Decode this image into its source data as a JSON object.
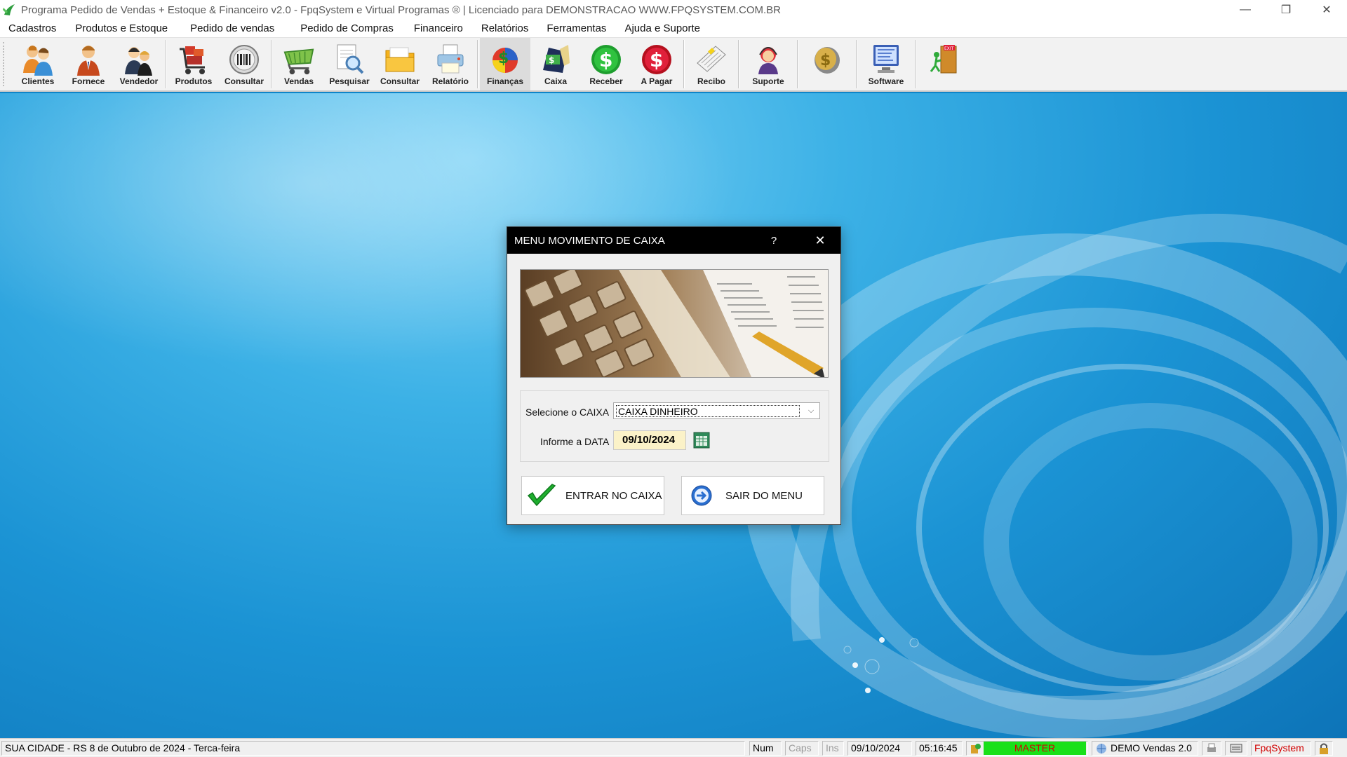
{
  "window": {
    "title": "Programa Pedido de Vendas + Estoque & Financeiro v2.0 - FpqSystem e Virtual Programas ® | Licenciado para  DEMONSTRACAO WWW.FPQSYSTEM.COM.BR",
    "controls": {
      "minimize": "—",
      "restore": "❐",
      "close": "✕"
    }
  },
  "menu": [
    "Cadastros",
    "Produtos e Estoque",
    "Pedido de vendas",
    "Pedido de Compras",
    "Financeiro",
    "Relatórios",
    "Ferramentas",
    "Ajuda e Suporte"
  ],
  "toolbar": {
    "clientes": "Clientes",
    "fornece": "Fornece",
    "vendedor": "Vendedor",
    "produtos": "Produtos",
    "consultar1": "Consultar",
    "vendas": "Vendas",
    "pesquisar": "Pesquisar",
    "consultar2": "Consultar",
    "relatorio": "Relatório",
    "financas": "Finanças",
    "caixa": "Caixa",
    "receber": "Receber",
    "apagar": "A Pagar",
    "recibo": "Recibo",
    "suporte": "Suporte",
    "software": "Software"
  },
  "dialog": {
    "title": "MENU MOVIMENTO DE CAIXA",
    "help": "?",
    "close": "✕",
    "caixa_label": "Selecione o CAIXA",
    "caixa_value": "CAIXA DINHEIRO",
    "data_label": "Informe a DATA",
    "data_value": "09/10/2024",
    "entrar_label": "ENTRAR NO CAIXA",
    "sair_label": "SAIR DO MENU"
  },
  "statusbar": {
    "location": "SUA CIDADE - RS  8 de Outubro de 2024 - Terca-feira",
    "num": "Num",
    "caps": "Caps",
    "ins": "Ins",
    "date": "09/10/2024",
    "time": "05:16:45",
    "user": "MASTER",
    "version": "DEMO Vendas 2.0",
    "brand": "FpqSystem"
  },
  "colors": {
    "desktop": "#1b93d4",
    "dialog_title": "#000000",
    "date_field": "#fbf2c8",
    "master_badge": "#19e019"
  }
}
